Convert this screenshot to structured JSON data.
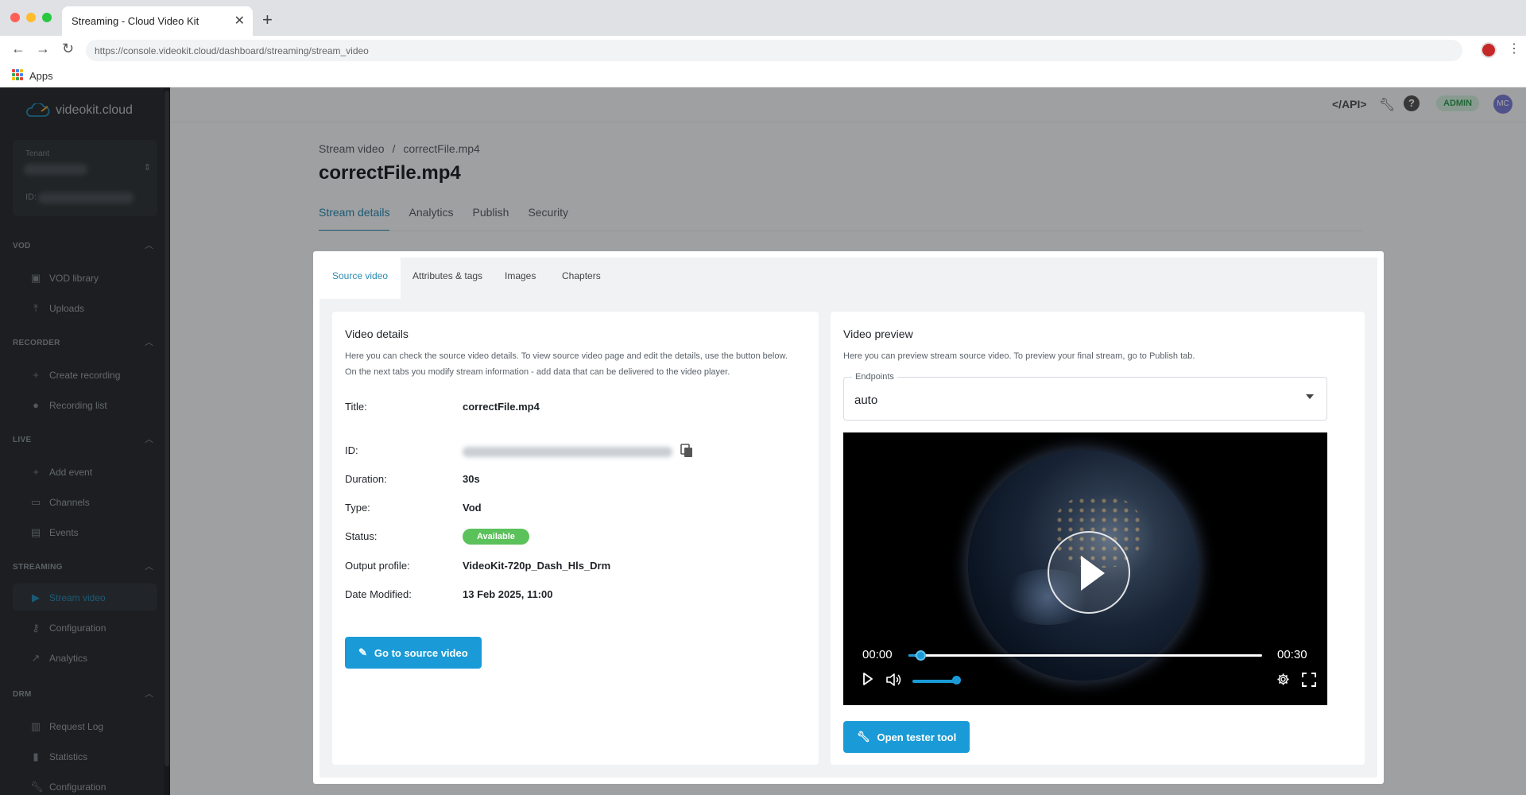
{
  "browser": {
    "tab_title": "Streaming - Cloud Video Kit",
    "url": "https://console.videokit.cloud/dashboard/streaming/stream_video",
    "bookmarks_apps": "Apps"
  },
  "sidebar": {
    "logo": "videokit.cloud",
    "tenant_label": "Tenant",
    "tenant_id_label": "ID:",
    "sections": [
      {
        "heading": "VOD",
        "items": [
          {
            "label": "VOD library",
            "icon": "library-icon"
          },
          {
            "label": "Uploads",
            "icon": "upload-icon"
          }
        ]
      },
      {
        "heading": "RECORDER",
        "items": [
          {
            "label": "Create recording",
            "icon": "plus-icon"
          },
          {
            "label": "Recording list",
            "icon": "record-icon"
          }
        ]
      },
      {
        "heading": "LIVE",
        "items": [
          {
            "label": "Add event",
            "icon": "plus-icon"
          },
          {
            "label": "Channels",
            "icon": "monitor-icon"
          },
          {
            "label": "Events",
            "icon": "calendar-icon"
          }
        ]
      },
      {
        "heading": "STREAMING",
        "items": [
          {
            "label": "Stream video",
            "icon": "play-circle-icon",
            "active": true
          },
          {
            "label": "Configuration",
            "icon": "key-icon"
          },
          {
            "label": "Analytics",
            "icon": "trend-icon"
          }
        ]
      },
      {
        "heading": "DRM",
        "items": [
          {
            "label": "Request Log",
            "icon": "log-icon"
          },
          {
            "label": "Statistics",
            "icon": "bar-chart-icon"
          },
          {
            "label": "Configuration",
            "icon": "wrench-icon"
          }
        ]
      }
    ]
  },
  "topbar": {
    "api": "</API>",
    "role_badge": "ADMIN",
    "avatar_initials": "MC"
  },
  "page": {
    "breadcrumb_root": "Stream video",
    "breadcrumb_sep": "/",
    "breadcrumb_current": "correctFile.mp4",
    "title": "correctFile.mp4",
    "tabs": [
      "Stream details",
      "Analytics",
      "Publish",
      "Security"
    ]
  },
  "card": {
    "sub_tabs": [
      "Source video",
      "Attributes & tags",
      "Images",
      "Chapters"
    ],
    "video_details": {
      "title": "Video details",
      "desc_line1": "Here you can check the source video details. To view source video page and edit the details, use the button below.",
      "desc_line2": "On the next tabs you modify stream information - add data that can be delivered to the video player.",
      "labels": {
        "title": "Title:",
        "id": "ID:",
        "duration": "Duration:",
        "type": "Type:",
        "status": "Status:",
        "output_profile": "Output profile:",
        "date_modified": "Date Modified:"
      },
      "values": {
        "title": "correctFile.mp4",
        "duration": "30s",
        "type": "Vod",
        "status": "Available",
        "output_profile": "VideoKit-720p_Dash_Hls_Drm",
        "date_modified": "13 Feb 2025, 11:00"
      },
      "button": "Go to source video"
    },
    "video_preview": {
      "title": "Video preview",
      "desc": "Here you can preview stream source video. To preview your final stream, go to Publish tab.",
      "endpoints_label": "Endpoints",
      "endpoints_value": "auto",
      "player": {
        "current_time": "00:00",
        "duration": "00:30",
        "progress": 0.02,
        "volume": 1.0
      },
      "button": "Open tester tool"
    }
  },
  "colors": {
    "accent": "#1a9bd7",
    "status_available": "#5bc15b",
    "sidebar_bg": "#2b2f33"
  }
}
